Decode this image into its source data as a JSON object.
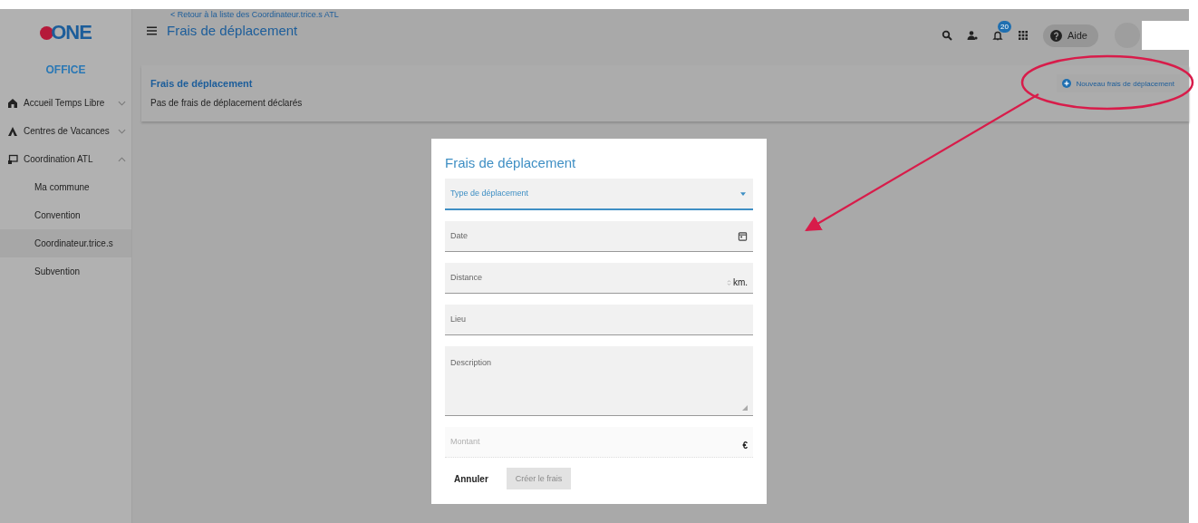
{
  "logo": {
    "text": "ONE"
  },
  "sidebar": {
    "brand": "OFFICE",
    "items": [
      {
        "label": "Accueil Temps Libre",
        "expanded": false
      },
      {
        "label": "Centres de Vacances",
        "expanded": false
      },
      {
        "label": "Coordination ATL",
        "expanded": true,
        "children": [
          {
            "label": "Ma commune",
            "selected": false
          },
          {
            "label": "Convention",
            "selected": false
          },
          {
            "label": "Coordinateur.trice.s",
            "selected": true
          },
          {
            "label": "Subvention",
            "selected": false
          }
        ]
      }
    ]
  },
  "header": {
    "back_link": "< Retour à la liste des Coordinateur.trice.s ATL",
    "title": "Frais de déplacement",
    "notification_count": "20",
    "help": "Aide"
  },
  "card": {
    "title": "Frais de déplacement",
    "empty_message": "Pas de frais de déplacement déclarés",
    "new_button": "Nouveau frais de déplacement"
  },
  "dialog": {
    "title": "Frais de déplacement",
    "fields": [
      {
        "kind": "select",
        "label": "Type de déplacement",
        "focused": true,
        "disabled": false
      },
      {
        "kind": "date",
        "label": "Date",
        "focused": false,
        "disabled": false
      },
      {
        "kind": "number",
        "label": "Distance",
        "suffix": "km.",
        "focused": false,
        "disabled": false
      },
      {
        "kind": "text",
        "label": "Lieu",
        "focused": false,
        "disabled": false
      },
      {
        "kind": "textarea",
        "label": "Description",
        "focused": false,
        "disabled": false
      },
      {
        "kind": "amount",
        "label": "Montant",
        "suffix": "€",
        "focused": false,
        "disabled": true
      }
    ],
    "cancel": "Annuler",
    "submit": {
      "label": "Créer le frais",
      "disabled": true
    }
  }
}
